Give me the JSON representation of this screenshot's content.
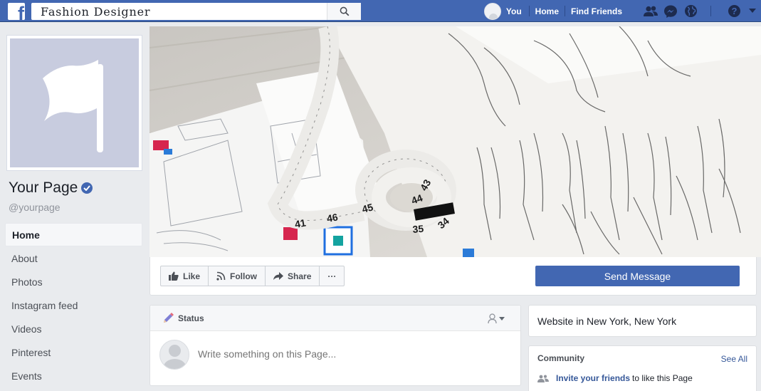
{
  "topbar": {
    "logo_letter": "f",
    "search_value": "Fashion Designer",
    "profile_label": "You",
    "home_label": "Home",
    "find_friends_label": "Find Friends",
    "brand_color": "#4267b2"
  },
  "page": {
    "name": "Your Page",
    "handle": "@yourpage"
  },
  "side_nav": {
    "items": [
      {
        "label": "Home",
        "active": true
      },
      {
        "label": "About"
      },
      {
        "label": "Photos"
      },
      {
        "label": "Instagram feed"
      },
      {
        "label": "Videos"
      },
      {
        "label": "Pinterest"
      },
      {
        "label": "Events"
      }
    ]
  },
  "actions": {
    "like_label": "Like",
    "follow_label": "Follow",
    "share_label": "Share",
    "more_label": "···",
    "send_message_label": "Send Message"
  },
  "composer": {
    "title": "Status",
    "placeholder": "Write something on this Page..."
  },
  "sidebar_right": {
    "website_text": "Website in New York, New York",
    "community_title": "Community",
    "see_all_label": "See All",
    "invite_link": "Invite your friends",
    "invite_suffix": "to like this Page"
  },
  "cover": {
    "tape_numbers": [
      "43",
      "44",
      "45",
      "46",
      "35",
      "34",
      "41"
    ]
  }
}
